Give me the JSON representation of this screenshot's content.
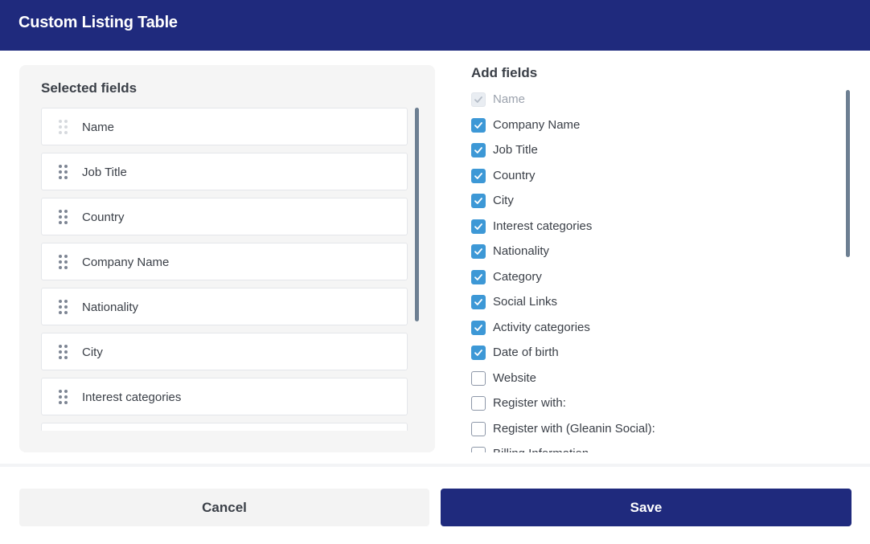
{
  "header": {
    "title": "Custom Listing Table"
  },
  "selected": {
    "title": "Selected fields",
    "items": [
      {
        "label": "Name",
        "locked": true
      },
      {
        "label": "Job Title",
        "locked": false
      },
      {
        "label": "Country",
        "locked": false
      },
      {
        "label": "Company Name",
        "locked": false
      },
      {
        "label": "Nationality",
        "locked": false
      },
      {
        "label": "City",
        "locked": false
      },
      {
        "label": "Interest categories",
        "locked": false
      }
    ]
  },
  "add": {
    "title": "Add fields",
    "items": [
      {
        "label": "Name",
        "checked": true,
        "disabled": true
      },
      {
        "label": "Company Name",
        "checked": true,
        "disabled": false
      },
      {
        "label": "Job Title",
        "checked": true,
        "disabled": false
      },
      {
        "label": "Country",
        "checked": true,
        "disabled": false
      },
      {
        "label": "City",
        "checked": true,
        "disabled": false
      },
      {
        "label": "Interest categories",
        "checked": true,
        "disabled": false
      },
      {
        "label": "Nationality",
        "checked": true,
        "disabled": false
      },
      {
        "label": "Category",
        "checked": true,
        "disabled": false
      },
      {
        "label": "Social Links",
        "checked": true,
        "disabled": false
      },
      {
        "label": "Activity categories",
        "checked": true,
        "disabled": false
      },
      {
        "label": "Date of birth",
        "checked": true,
        "disabled": false
      },
      {
        "label": "Website",
        "checked": false,
        "disabled": false
      },
      {
        "label": "Register with:",
        "checked": false,
        "disabled": false
      },
      {
        "label": "Register with (Gleanin Social):",
        "checked": false,
        "disabled": false
      },
      {
        "label": "Billing Information",
        "checked": false,
        "disabled": false
      }
    ]
  },
  "footer": {
    "cancel_label": "Cancel",
    "save_label": "Save"
  },
  "colors": {
    "brand": "#1f2a7d",
    "checkbox_checked": "#3d98d6",
    "scrollbar": "#6d7f92"
  }
}
